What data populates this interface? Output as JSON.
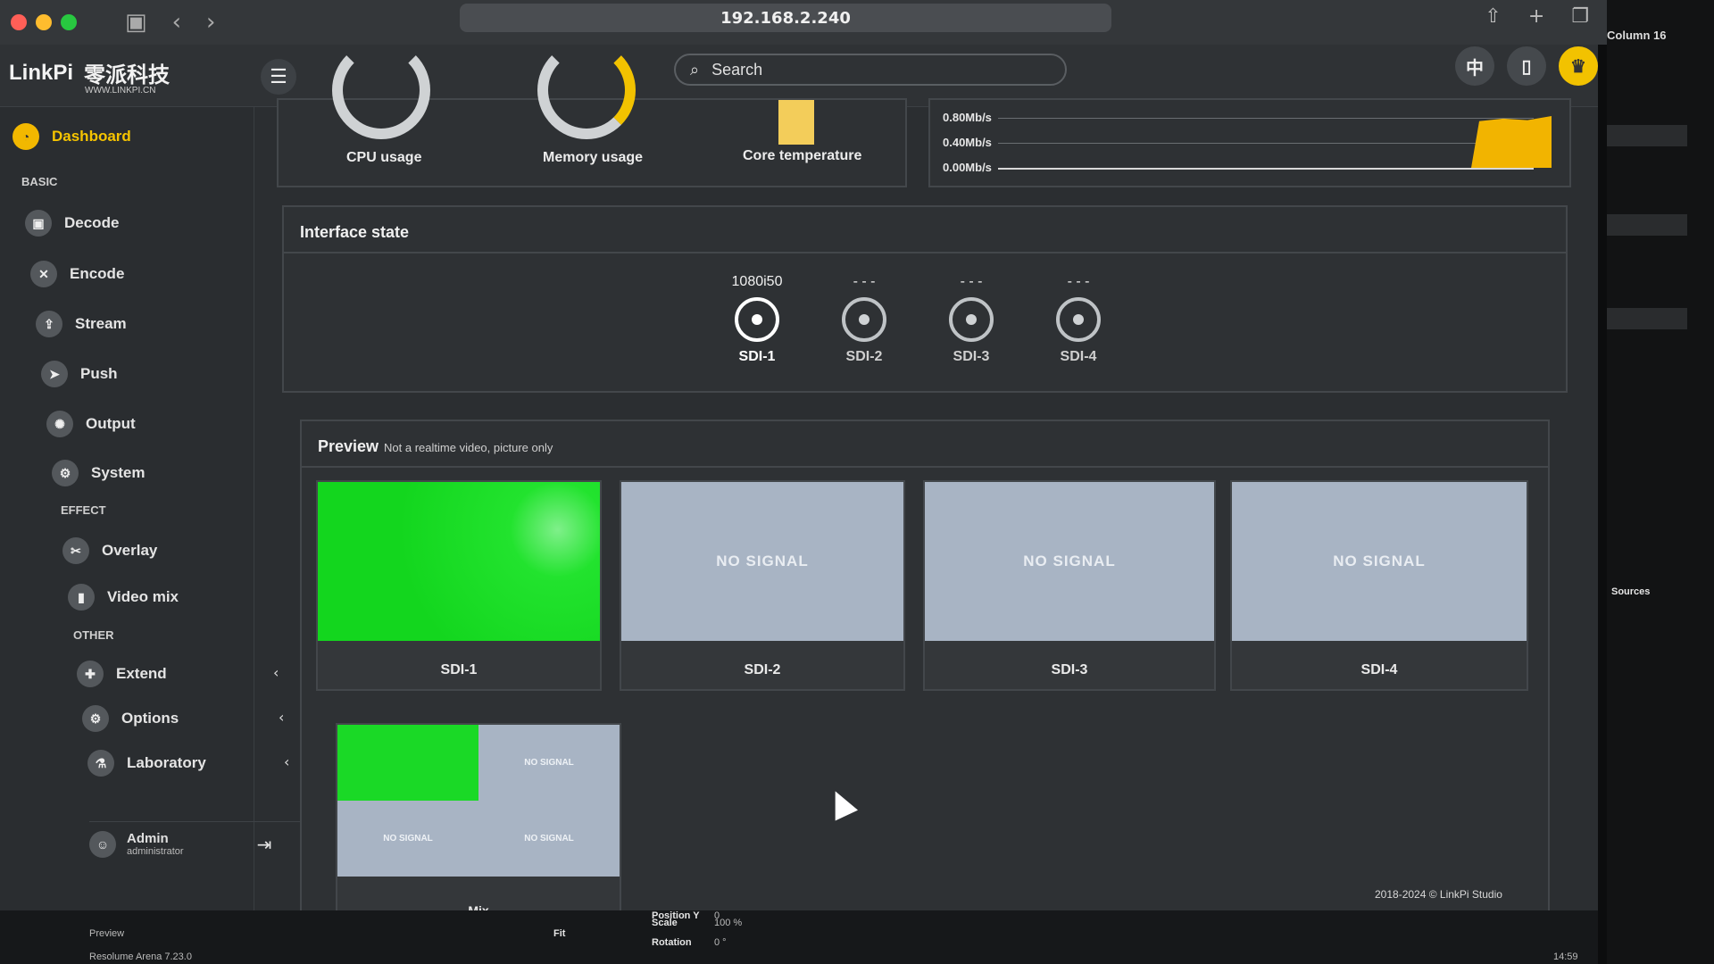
{
  "browser": {
    "url": "192.168.2.240",
    "right_panel_label": "Column 16"
  },
  "app": {
    "logo_text": "LinkPi",
    "logo_cn": "零派科技",
    "logo_url": "WWW.LINKPI.CN",
    "search_placeholder": "Search",
    "lang_icon": "中",
    "copyright": "2018-2024 © LinkPi Studio"
  },
  "sidebar": {
    "active": "Dashboard",
    "sections": {
      "basic": "BASIC",
      "effect": "EFFECT",
      "other": "OTHER"
    },
    "items": [
      {
        "label": "Dashboard",
        "icon": "dashboard-icon"
      },
      {
        "label": "Decode",
        "icon": "image-icon"
      },
      {
        "label": "Encode",
        "icon": "encode-icon"
      },
      {
        "label": "Stream",
        "icon": "stream-icon"
      },
      {
        "label": "Push",
        "icon": "push-icon"
      },
      {
        "label": "Output",
        "icon": "output-icon"
      },
      {
        "label": "System",
        "icon": "gear-icon"
      },
      {
        "label": "Overlay",
        "icon": "overlay-icon"
      },
      {
        "label": "Video mix",
        "icon": "bar-chart-icon"
      },
      {
        "label": "Extend",
        "icon": "puzzle-icon"
      },
      {
        "label": "Options",
        "icon": "gears-icon"
      },
      {
        "label": "Laboratory",
        "icon": "flask-icon"
      }
    ],
    "user": {
      "name": "Admin",
      "role": "administrator"
    }
  },
  "stats": {
    "cpu_label": "CPU usage",
    "memory_label": "Memory usage",
    "temp_label": "Core temperature",
    "net_ticks": [
      "0.80Mb/s",
      "0.40Mb/s",
      "0.00Mb/s"
    ]
  },
  "interface_state": {
    "title": "Interface state",
    "ports": [
      {
        "name": "SDI-1",
        "resolution": "1080i50",
        "active": true
      },
      {
        "name": "SDI-2",
        "resolution": "- - -",
        "active": false
      },
      {
        "name": "SDI-3",
        "resolution": "- - -",
        "active": false
      },
      {
        "name": "SDI-4",
        "resolution": "- - -",
        "active": false
      }
    ]
  },
  "preview": {
    "title": "Preview",
    "subtitle": "Not a realtime video, picture only",
    "no_signal": "NO SIGNAL",
    "cards": [
      {
        "label": "SDI-1",
        "signal": true
      },
      {
        "label": "SDI-2",
        "signal": false
      },
      {
        "label": "SDI-3",
        "signal": false
      },
      {
        "label": "SDI-4",
        "signal": false
      }
    ],
    "mix_label": "Mix",
    "mix_cells": [
      "",
      "NO SIGNAL",
      "NO SIGNAL",
      "NO SIGNAL"
    ]
  },
  "host_app": {
    "preview_label": "Preview",
    "version": "Resolume Arena 7.23.0",
    "fit_label": "Fit",
    "position_label": "Position Y",
    "position_value": "0",
    "scale_label": "Scale",
    "scale_value": "100 %",
    "rotation_label": "Rotation",
    "rotation_value": "0 °",
    "sources_label": "Sources",
    "clock": "14:59"
  },
  "colors": {
    "accent": "#f2b800",
    "signal_green": "#13d61e",
    "no_signal_bg": "#a8b4c4",
    "traffic_red": "#ff5f57",
    "traffic_yellow": "#febc2e",
    "traffic_green": "#28c840"
  }
}
